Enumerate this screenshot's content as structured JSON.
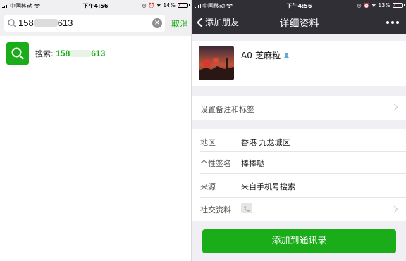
{
  "left": {
    "status": {
      "carrier": "中国移动",
      "time": "下午4:56",
      "battery": "14%"
    },
    "search": {
      "query_start": "158",
      "query_end": "613",
      "cancel": "取消"
    },
    "result": {
      "label": "搜索:",
      "num_start": "158",
      "num_end": "613"
    }
  },
  "right": {
    "status": {
      "carrier": "中国移动",
      "time": "下午4:56",
      "battery": "13%"
    },
    "nav": {
      "back": "添加朋友",
      "title": "详细资料"
    },
    "profile": {
      "name": "A0-芝麻粒"
    },
    "tags_row": "设置备注和标签",
    "info": [
      {
        "label": "地区",
        "value": "香港 九龙城区"
      },
      {
        "label": "个性签名",
        "value": "棒棒哒"
      },
      {
        "label": "来源",
        "value": "来自手机号搜索"
      },
      {
        "label": "社交资料",
        "value": ""
      }
    ],
    "add_button": "添加到通讯录"
  },
  "colors": {
    "accent": "#1aad19",
    "nav_bg": "#2f2f35",
    "page_bg": "#efeff4"
  },
  "icons": [
    "search-icon",
    "clear-icon",
    "back-chevron-icon",
    "more-icon",
    "gender-icon",
    "chevron-right-icon",
    "phone-icon",
    "wifi-icon",
    "battery-icon"
  ]
}
